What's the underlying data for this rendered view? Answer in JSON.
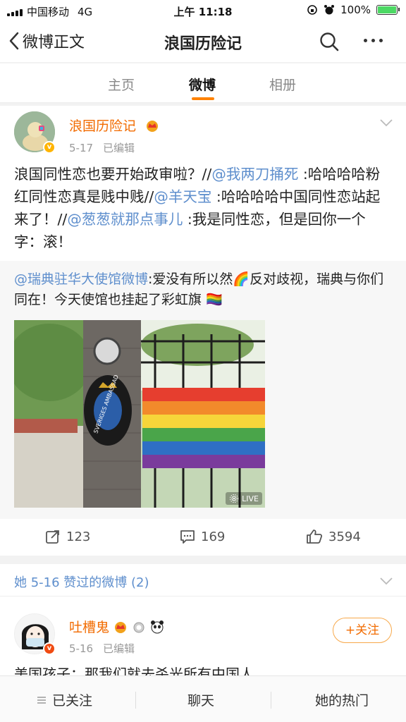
{
  "status_bar": {
    "carrier": "中国移动",
    "network": "4G",
    "time": "上午 11:18",
    "battery": "100%"
  },
  "nav": {
    "back_label": "微博正文",
    "title": "浪国历险记"
  },
  "tabs": [
    {
      "label": "主页"
    },
    {
      "label": "微博"
    },
    {
      "label": "相册"
    }
  ],
  "post": {
    "author": "浪国历险记",
    "date": "5-17",
    "edited": "已编辑",
    "text_segments": [
      "浪国同性恋也要开始政审啦？//",
      "@我两刀捅死",
      " :哈哈哈哈粉红同性恋真是贱中贱//",
      "@羊天宝",
      " :哈哈哈哈中国同性恋站起来了！//",
      "@葱葱就那点事儿",
      " :我是同性恋，但是回你一个字：滚！"
    ],
    "retweet": {
      "author_mention": "@瑞典驻华大使馆微博",
      "text": ":爱没有所以然🌈反对歧视，瑞典与你们同在！今天使馆也挂起了彩虹旗 🏳️‍🌈",
      "image_badge": "LIVE",
      "sign_text": "SVERIGES AMBASSAD"
    },
    "actions": {
      "repost_count": "123",
      "comment_count": "169",
      "like_count": "3594"
    }
  },
  "liked_section": {
    "title": "她 5-16 赞过的微博 (2)",
    "post": {
      "author": "吐槽鬼",
      "date": "5-16",
      "edited": "已编辑",
      "follow_label": "+关注",
      "text": "美国孩子：那我们就去杀光所有中国人"
    }
  },
  "bottom_bar": {
    "followed": "已关注",
    "chat": "聊天",
    "hot": "她的热门"
  },
  "colors": {
    "accent": "#ff8200",
    "link": "#5f8fcd",
    "author": "#f26b00"
  }
}
